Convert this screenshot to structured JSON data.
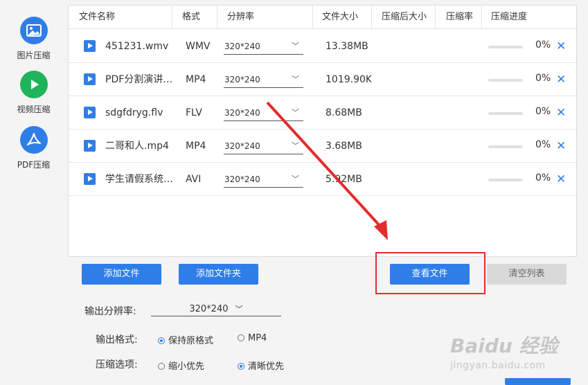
{
  "sidebar": {
    "items": [
      {
        "label": "图片压缩",
        "icon": "image-icon",
        "active": false
      },
      {
        "label": "视频压缩",
        "icon": "play-icon",
        "active": true
      },
      {
        "label": "PDF压缩",
        "icon": "pdf-icon",
        "active": false
      }
    ]
  },
  "table": {
    "headers": {
      "name": "文件名称",
      "format": "格式",
      "resolution": "分辨率",
      "size": "文件大小",
      "compressed_size": "压缩后大小",
      "ratio": "压缩率",
      "progress": "压缩进度"
    },
    "rows": [
      {
        "name": "451231.wmv",
        "format": "WMV",
        "resolution": "320*240",
        "size": "13.38MB",
        "progress": 0,
        "pct": "0%"
      },
      {
        "name": "PDF分割演讲…",
        "format": "MP4",
        "resolution": "320*240",
        "size": "1019.90KB",
        "progress": 0,
        "pct": "0%"
      },
      {
        "name": "sdgfdryg.flv",
        "format": "FLV",
        "resolution": "320*240",
        "size": "8.68MB",
        "progress": 0,
        "pct": "0%"
      },
      {
        "name": "二哥和人.mp4",
        "format": "MP4",
        "resolution": "320*240",
        "size": "3.68MB",
        "progress": 0,
        "pct": "0%"
      },
      {
        "name": "学生请假系统…",
        "format": "AVI",
        "resolution": "320*240",
        "size": "5.92MB",
        "progress": 0,
        "pct": "0%"
      }
    ],
    "delete_glyph": "✕"
  },
  "buttons": {
    "add_file": "添加文件",
    "add_folder": "添加文件夹",
    "view_file": "查看文件",
    "clear_list": "清空列表"
  },
  "options": {
    "resolution_label": "输出分辨率:",
    "resolution_value": "320*240",
    "format_label": "输出格式:",
    "format_options": [
      "保持原格式",
      "MP4"
    ],
    "format_selected": "保持原格式",
    "compress_label": "压缩选项:",
    "compress_options": [
      "缩小优先",
      "清晰优先"
    ],
    "compress_selected": "清晰优先"
  },
  "watermark": {
    "main": "Baidu 经验",
    "sub": "jingyan.baidu.com"
  },
  "colors": {
    "accent": "#2f7ee8",
    "active": "#21b35a",
    "annotation": "#e32b2b"
  }
}
